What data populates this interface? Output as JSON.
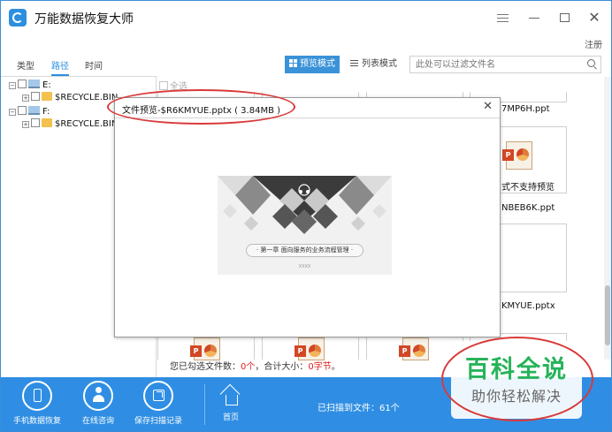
{
  "app": {
    "title": "万能数据恢复大师",
    "register": "注册"
  },
  "tabs": [
    {
      "label": "类型"
    },
    {
      "label": "路径"
    },
    {
      "label": "时间"
    }
  ],
  "toolbar": {
    "preview_mode": "预览模式",
    "list_mode": "列表模式",
    "filter_placeholder": "此处可以过滤文件名"
  },
  "tree": [
    {
      "label": "E:"
    },
    {
      "label": "$RECYCLE.BIN"
    },
    {
      "label": "F:"
    },
    {
      "label": "$RECYCLE.BIN"
    }
  ],
  "content": {
    "select_all": "全选",
    "files": [
      {
        "name": "7MP6H.ppt"
      },
      {
        "name": "式不支持预览"
      },
      {
        "name": "NBEB6K.ppt"
      },
      {
        "name": "KMYUE.pptx"
      }
    ]
  },
  "status": {
    "prefix": "您已勾选文件数：",
    "count": "0个",
    "middle": "，合计大小：",
    "size": "0字节",
    "suffix": "。"
  },
  "bottombar": {
    "phone": "手机数据恢复",
    "consult": "在线咨询",
    "save": "保存扫描记录",
    "home": "首页",
    "scanned": "已扫描到文件：61个"
  },
  "dialog": {
    "title": "文件预览-$R6KMYUE.pptx ( 3.84MB )",
    "slide_caption": "· 第一章  面向服务的业务流程管理 ·",
    "slide_sub": "XXXX"
  },
  "watermark": {
    "title": "百科全说",
    "subtitle": "助你轻松解决"
  },
  "colors": {
    "accent": "#2f8ee3",
    "highlight": "#d93a3a",
    "watermark": "#26b35a"
  }
}
